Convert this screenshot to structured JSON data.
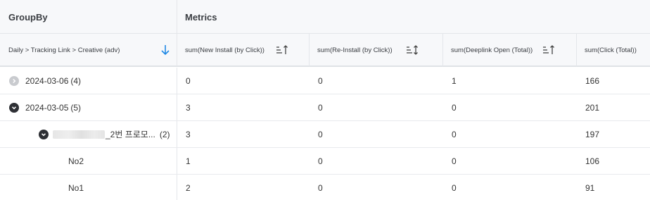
{
  "header": {
    "groupby_title": "GroupBy",
    "metrics_title": "Metrics"
  },
  "columns": {
    "groupby_path": "Daily > Tracking Link > Creative (adv)",
    "metrics": [
      "sum(New Install (by Click))",
      "sum(Re-Install (by Click))",
      "sum(Deeplink Open (Total))",
      "sum(Click (Total))"
    ]
  },
  "icons": {
    "sort_desc": "arrow-down-icon",
    "sort_toggle": "sort-toggle-icon",
    "collapsed": "chevron-right-icon",
    "expanded": "chevron-down-icon"
  },
  "colors": {
    "accent": "#1e88e5",
    "header_bg": "#f7f8fa",
    "toggle_collapsed": "#c9cbcf",
    "toggle_expanded": "#2e3035"
  },
  "rows": [
    {
      "label": "2024-03-06",
      "count": "(4)",
      "values": [
        "0",
        "0",
        "1",
        "166"
      ]
    },
    {
      "label": "2024-03-05",
      "count": "(5)",
      "values": [
        "3",
        "0",
        "0",
        "201"
      ]
    },
    {
      "label": "_2번 프로모...",
      "count": "(2)",
      "values": [
        "3",
        "0",
        "0",
        "197"
      ]
    },
    {
      "label": "No2",
      "values": [
        "1",
        "0",
        "0",
        "106"
      ]
    },
    {
      "label": "No1",
      "values": [
        "2",
        "0",
        "0",
        "91"
      ]
    }
  ]
}
